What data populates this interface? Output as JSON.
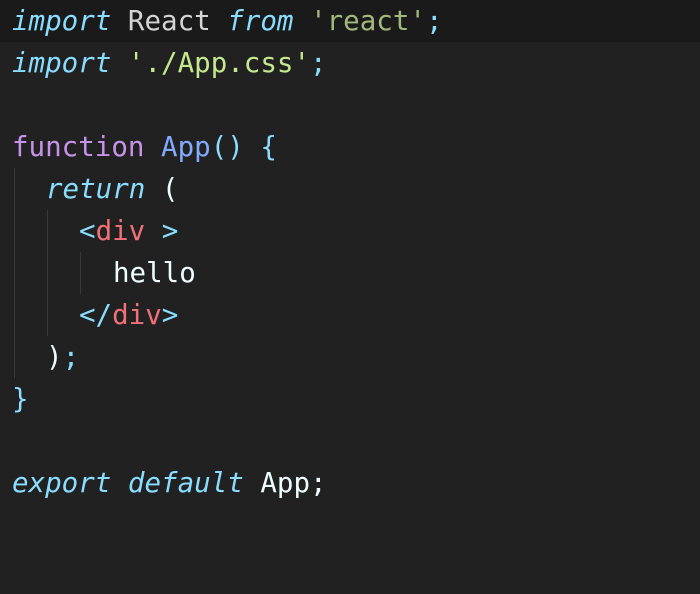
{
  "editor": {
    "language": "javascript",
    "theme": {
      "background": "#212121",
      "keyword_import": "#89ddff",
      "keyword_function": "#c792ea",
      "function_name": "#82aaff",
      "string": "#c3e88d",
      "tag": "#f07178",
      "punctuation": "#89ddff",
      "text": "#eeffff"
    },
    "lines": {
      "l1": {
        "kw1": "import",
        "id": "React",
        "kw2": "from",
        "str": "'react'",
        "end": ";"
      },
      "l2": {
        "kw": "import",
        "str": "'./App.css'",
        "end": ";"
      },
      "l4": {
        "kw": "function",
        "name": "App",
        "parens": "()",
        "brace": "{"
      },
      "l5": {
        "kw": "return",
        "paren": "("
      },
      "l6": {
        "open": "<",
        "tag": "div",
        "close": " >"
      },
      "l7": {
        "text": "hello"
      },
      "l8": {
        "open": "</",
        "tag": "div",
        "close": ">"
      },
      "l9": {
        "paren": ")",
        "end": ";"
      },
      "l10": {
        "brace": "}"
      },
      "l12": {
        "kw1": "export",
        "kw2": "default",
        "id": "App",
        "end": ";"
      }
    }
  }
}
